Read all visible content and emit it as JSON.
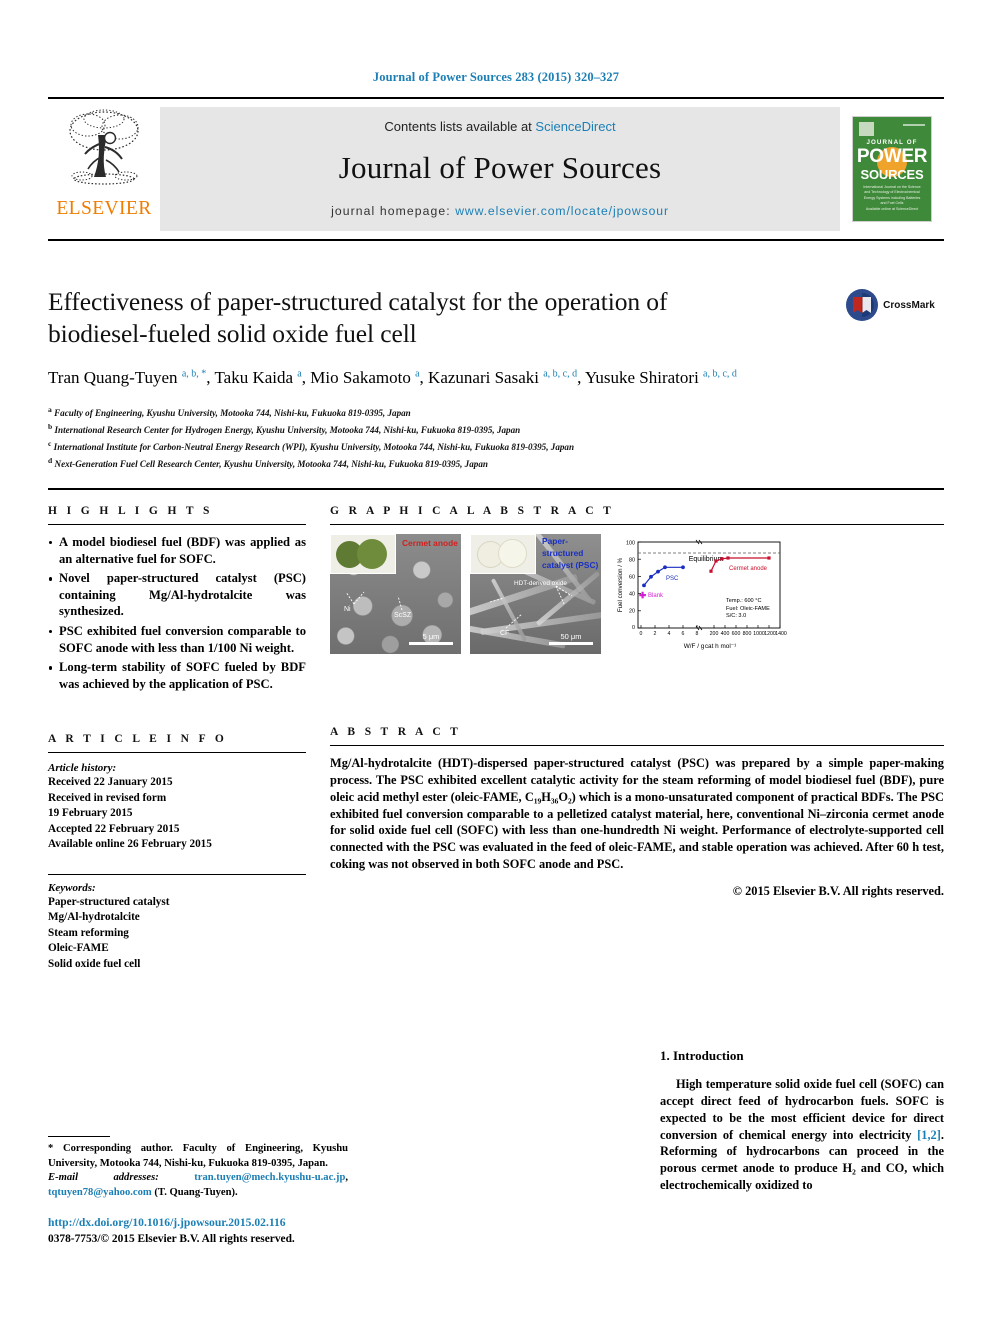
{
  "running_head": "Journal of Power Sources 283 (2015) 320–327",
  "masthead": {
    "publisher": "ELSEVIER",
    "contents_prefix": "Contents lists available at ",
    "contents_link": "ScienceDirect",
    "journal_title": "Journal of Power Sources",
    "homepage_prefix": "journal homepage: ",
    "homepage_url": "www.elsevier.com/locate/jpowsour",
    "cover": {
      "line1": "JOURNAL OF",
      "line2": "POWER",
      "line3": "SOURCES",
      "subtitle": "International Journal on the Science and Technology of Electrochemical Energy Systems including Batteries and Fuel Cells",
      "footer": "Available online at\nScienceDirect"
    }
  },
  "article": {
    "title": "Effectiveness of paper-structured catalyst for the operation of biodiesel-fueled solid oxide fuel cell",
    "authors_html": "Tran Quang-Tuyen <sup>a, b, *</sup>, Taku Kaida <sup>a</sup>, Mio Sakamoto <sup>a</sup>, Kazunari Sasaki <sup>a, b, c, d</sup>, Yusuke Shiratori <sup>a, b, c, d</sup>",
    "affiliations": [
      {
        "marker": "a",
        "text": "Faculty of Engineering, Kyushu University, Motooka 744, Nishi-ku, Fukuoka 819-0395, Japan"
      },
      {
        "marker": "b",
        "text": "International Research Center for Hydrogen Energy, Kyushu University, Motooka 744, Nishi-ku, Fukuoka 819-0395, Japan"
      },
      {
        "marker": "c",
        "text": "International Institute for Carbon-Neutral Energy Research (WPI), Kyushu University, Motooka 744, Nishi-ku, Fukuoka 819-0395, Japan"
      },
      {
        "marker": "d",
        "text": "Next-Generation Fuel Cell Research Center, Kyushu University, Motooka 744, Nishi-ku, Fukuoka 819-0395, Japan"
      }
    ],
    "crossmark_label": "CrossMark"
  },
  "highlights": {
    "heading": "H I G H L I G H T S",
    "items": [
      "A model biodiesel fuel (BDF) was applied as an alternative fuel for SOFC.",
      "Novel paper-structured catalyst (PSC) containing Mg/Al-hydrotalcite was synthesized.",
      "PSC exhibited fuel conversion comparable to SOFC anode with less than 1/100 Ni weight.",
      "Long-term stability of SOFC fueled by BDF was achieved by the application of PSC."
    ]
  },
  "graphical_abstract": {
    "heading": "G R A P H I C A L   A B S T R A C T",
    "panel_a_label": "Cermet anode",
    "panel_b_label_line1": "Paper-structured",
    "panel_b_label_line2": "catalyst (PSC)",
    "panel_a_tags": [
      "Ni",
      "ScSZ"
    ],
    "panel_b_tags": [
      "HDT-derived oxide",
      "CF"
    ],
    "panel_a_scale": "5 μm",
    "panel_b_scale": "50 μm"
  },
  "chart_data": {
    "type": "line",
    "title": "",
    "xlabel": "W/F / gₒₐₜ h mol⁻¹",
    "ylabel": "Fuel conversion / %",
    "ylim": [
      0,
      100
    ],
    "yticks": [
      0,
      20,
      40,
      60,
      80,
      100
    ],
    "xticks_left": [
      0,
      2,
      4,
      6,
      8
    ],
    "xticks_right": [
      200,
      400,
      600,
      800,
      1000,
      1200,
      1400
    ],
    "annotations": [
      "Equilibrium",
      "Temp.: 600 °C",
      "Fuel: Oleic-FAME",
      "S/C: 3.0"
    ],
    "series": [
      {
        "name": "PSC",
        "color": "#1a2fc0",
        "x": [
          0.5,
          1.5,
          2.5,
          3.5,
          6.0
        ],
        "y": [
          60,
          70,
          76,
          81,
          81
        ]
      },
      {
        "name": "Cermet anode",
        "color": "#c8102e",
        "x": [
          250,
          300,
          380,
          450,
          1250
        ],
        "y": [
          66,
          78,
          80,
          81,
          81
        ]
      },
      {
        "name": "Blank",
        "color": "#d41fd4",
        "x": [
          0.2
        ],
        "y": [
          45
        ]
      }
    ],
    "equilibrium_line": 88
  },
  "article_info": {
    "heading": "A R T I C L E   I N F O",
    "history_label": "Article history:",
    "history": [
      "Received 22 January 2015",
      "Received in revised form",
      "19 February 2015",
      "Accepted 22 February 2015",
      "Available online 26 February 2015"
    ],
    "keywords_label": "Keywords:",
    "keywords": [
      "Paper-structured catalyst",
      "Mg/Al-hydrotalcite",
      "Steam reforming",
      "Oleic-FAME",
      "Solid oxide fuel cell"
    ]
  },
  "abstract": {
    "heading": "A B S T R A C T",
    "text": "Mg/Al-hydrotalcite (HDT)-dispersed paper-structured catalyst (PSC) was prepared by a simple paper-making process. The PSC exhibited excellent catalytic activity for the steam reforming of model biodiesel fuel (BDF), pure oleic acid methyl ester (oleic-FAME, C₁₉H₃₆O₂) which is a mono-unsaturated component of practical BDFs. The PSC exhibited fuel conversion comparable to a pelletized catalyst material, here, conventional Ni–zirconia cermet anode for solid oxide fuel cell (SOFC) with less than one-hundredth Ni weight. Performance of electrolyte-supported cell connected with the PSC was evaluated in the feed of oleic-FAME, and stable operation was achieved. After 60 h test, coking was not observed in both SOFC anode and PSC.",
    "copyright": "© 2015 Elsevier B.V. All rights reserved."
  },
  "introduction": {
    "heading": "1.  Introduction",
    "paragraph_pre": "High temperature solid oxide fuel cell (SOFC) can accept direct feed of hydrocarbon fuels. SOFC is expected to be the most efficient device for direct conversion of chemical energy into electricity ",
    "citation": "[1,2]",
    "paragraph_post": ". Reforming of hydrocarbons can proceed in the porous cermet anode to produce H₂ and CO, which electrochemically oxidized to"
  },
  "footnote": {
    "corresponding": "* Corresponding author. Faculty of Engineering, Kyushu University, Motooka 744, Nishi-ku, Fukuoka 819-0395, Japan.",
    "email_label": "E-mail addresses:",
    "email1": "tran.tuyen@mech.kyushu-u.ac.jp",
    "email2": "tqtuyen78@yahoo.com",
    "email_owner": "(T. Quang-Tuyen).",
    "doi": "http://dx.doi.org/10.1016/j.jpowsour.2015.02.116",
    "issn": "0378-7753/© 2015 Elsevier B.V. All rights reserved."
  }
}
